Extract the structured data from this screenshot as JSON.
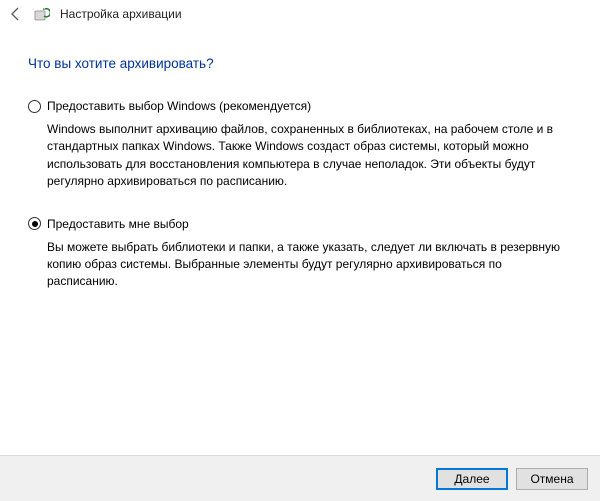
{
  "header": {
    "title": "Настройка архивации"
  },
  "question": "Что вы хотите архивировать?",
  "options": [
    {
      "label": "Предоставить выбор Windows (рекомендуется)",
      "desc": "Windows выполнит архивацию файлов, сохраненных в библиотеках, на рабочем столе и в стандартных папках Windows. Также Windows создаст образ системы, который можно использовать для восстановления компьютера в случае неполадок. Эти объекты будут регулярно архивироваться по расписанию.",
      "selected": false
    },
    {
      "label": "Предоставить мне выбор",
      "desc": "Вы можете выбрать библиотеки и папки, а также указать, следует ли включать в резервную копию образ системы. Выбранные элементы будут регулярно архивироваться по расписанию.",
      "selected": true
    }
  ],
  "footer": {
    "next": "Далее",
    "cancel": "Отмена"
  }
}
